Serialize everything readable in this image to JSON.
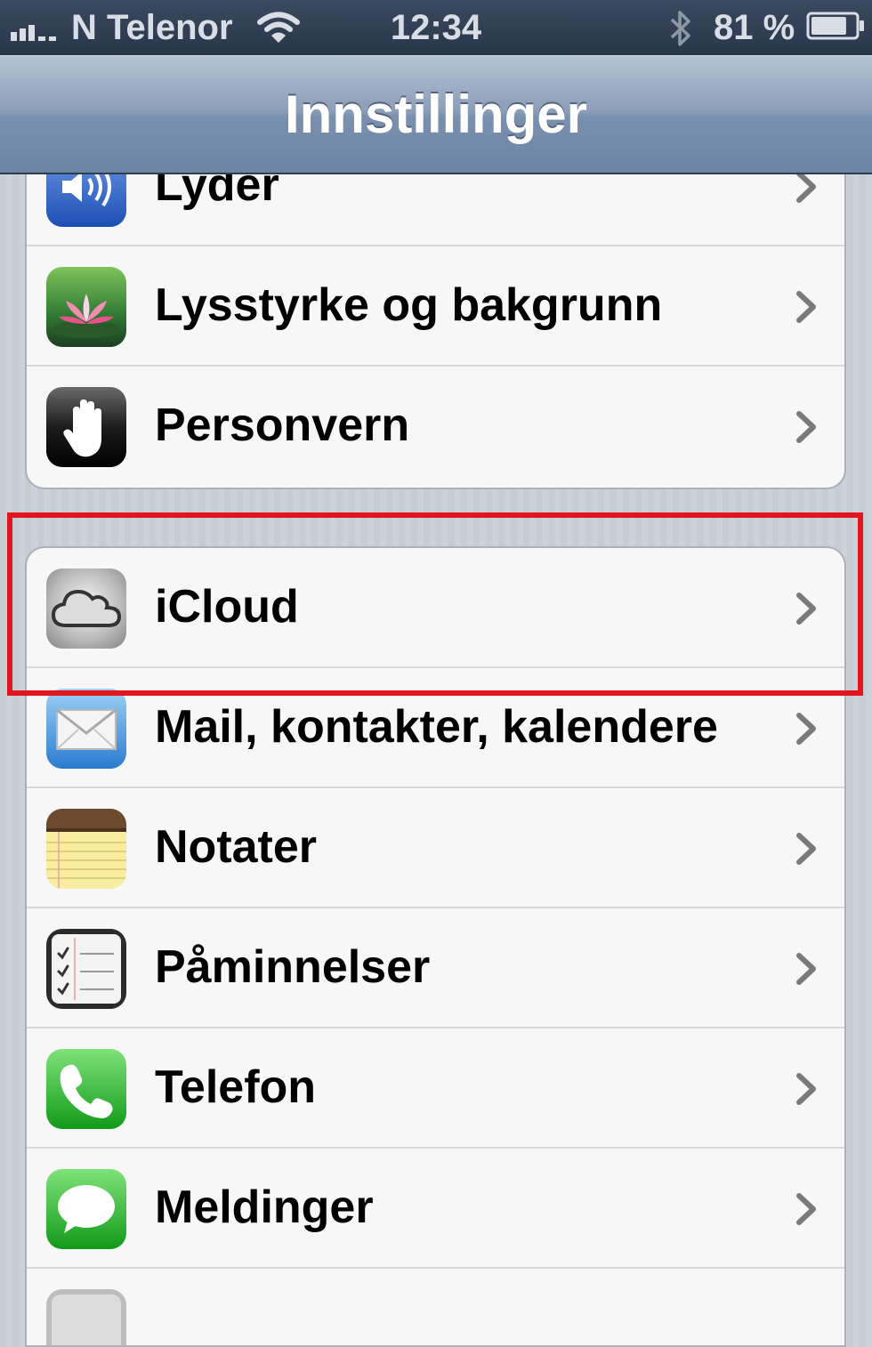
{
  "status_bar": {
    "carrier": "N Telenor",
    "time": "12:34",
    "battery_percent": "81 %",
    "battery_level": 0.81,
    "icons": [
      "signal-icon",
      "wifi-icon",
      "bluetooth-icon",
      "battery-icon"
    ]
  },
  "nav": {
    "title": "Innstillinger"
  },
  "groups": [
    {
      "items": [
        {
          "label": "Lyder",
          "icon": "speaker-icon"
        },
        {
          "label": "Lysstyrke og bakgrunn",
          "icon": "lotus-wallpaper-icon"
        },
        {
          "label": "Personvern",
          "icon": "hand-icon"
        }
      ]
    },
    {
      "items": [
        {
          "label": "iCloud",
          "icon": "cloud-icon"
        },
        {
          "label": "Mail, kontakter, kalendere",
          "icon": "mail-envelope-icon"
        },
        {
          "label": "Notater",
          "icon": "notepad-icon"
        },
        {
          "label": "Påminnelser",
          "icon": "checklist-icon"
        },
        {
          "label": "Telefon",
          "icon": "phone-icon"
        },
        {
          "label": "Meldinger",
          "icon": "speech-bubble-icon"
        },
        {
          "label": "",
          "icon": "app-icon-partial"
        }
      ]
    }
  ],
  "colors": {
    "highlight": "#e3151e",
    "nav_gradient_top": "#b6c3d5",
    "nav_gradient_bottom": "#6d84a4",
    "status_bar": "#28364a",
    "row_background": "#f7f7f7"
  }
}
